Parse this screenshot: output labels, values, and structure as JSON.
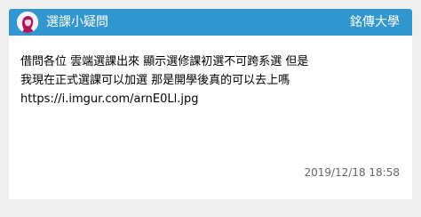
{
  "header": {
    "forum_name": "選課小疑問",
    "school_name": "銘傳大學",
    "accent_color": "#3397cf",
    "avatar_icon": "female-avatar-icon"
  },
  "post": {
    "lines": [
      "借問各位 雲端選課出來 顯示選修課初選不可跨系選 但是",
      "我現在正式選課可以加選  那是開學後真的可以去上嗎",
      " https://i.imgur.com/arnE0Ll.jpg"
    ],
    "timestamp": "2019/12/18 18:58"
  }
}
